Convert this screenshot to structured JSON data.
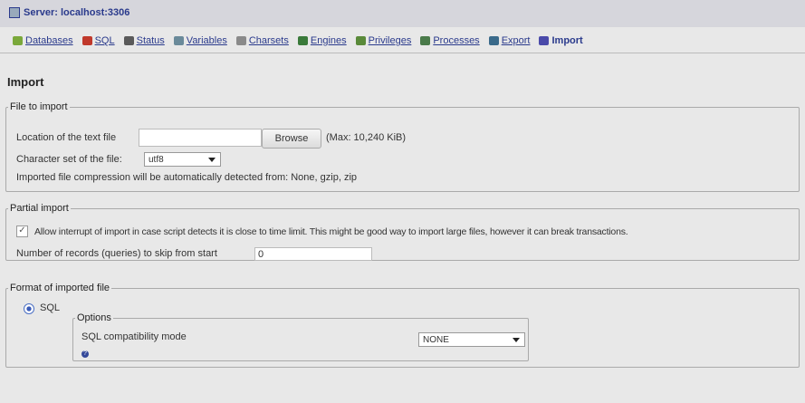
{
  "server": {
    "label": "Server: localhost:3306"
  },
  "tabs": [
    {
      "label": "Databases",
      "color": "#7aa83a"
    },
    {
      "label": "SQL",
      "color": "#c0392b"
    },
    {
      "label": "Status",
      "color": "#5a5a5a"
    },
    {
      "label": "Variables",
      "color": "#6a8a9a"
    },
    {
      "label": "Charsets",
      "color": "#8a8a8a"
    },
    {
      "label": "Engines",
      "color": "#3a7a3a"
    },
    {
      "label": "Privileges",
      "color": "#5a8a3a"
    },
    {
      "label": "Processes",
      "color": "#4a7a4a"
    },
    {
      "label": "Export",
      "color": "#3a6a8a"
    },
    {
      "label": "Import",
      "color": "#4a4aaa"
    }
  ],
  "page": {
    "title": "Import"
  },
  "file_section": {
    "legend": "File to import",
    "location_label": "Location of the text file",
    "browse_label": "Browse",
    "max_size": "(Max: 10,240 KiB)",
    "charset_label": "Character set of the file:",
    "charset_value": "utf8",
    "compression_note": "Imported file compression will be automatically detected from: None, gzip, zip"
  },
  "partial_section": {
    "legend": "Partial import",
    "interrupt_label": "Allow interrupt of import in case script detects it is close to time limit. This might be good way to import large files, however it can break transactions.",
    "skip_label": "Number of records (queries) to skip from start",
    "skip_value": "0"
  },
  "format_section": {
    "legend": "Format of imported file",
    "sql_label": "SQL",
    "options_legend": "Options",
    "compat_label": "SQL compatibility mode",
    "compat_value": "NONE"
  }
}
